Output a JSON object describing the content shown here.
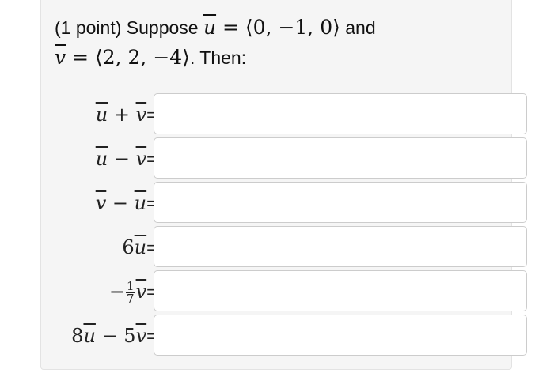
{
  "problem": {
    "points": "(1 point) Suppose ",
    "u_symbol": "u",
    "v_symbol": "v",
    "eq": " = ",
    "u_value": "⟨0, −1, 0⟩",
    "and_text": " and",
    "v_value": "⟨2, 2, −4⟩",
    "then_text": ". Then:"
  },
  "rows": [
    {
      "coef1": "",
      "sym1": "u",
      "op": " + ",
      "coef2": "",
      "sym2": "v",
      "equals": "=",
      "value": ""
    },
    {
      "coef1": "",
      "sym1": "u",
      "op": " − ",
      "coef2": "",
      "sym2": "v",
      "equals": "=",
      "value": ""
    },
    {
      "coef1": "",
      "sym1": "v",
      "op": " − ",
      "coef2": "",
      "sym2": "u",
      "equals": "=",
      "value": ""
    },
    {
      "coef1": "6",
      "sym1": "u",
      "equals": "=",
      "value": ""
    },
    {
      "sign": "−",
      "frac_num": "1",
      "frac_den": "7",
      "sym1": "v",
      "equals": "=",
      "value": ""
    },
    {
      "coef1": "8",
      "sym1": "u",
      "op": " − ",
      "coef2": "5",
      "sym2": "v",
      "equals": "=",
      "value": ""
    }
  ]
}
